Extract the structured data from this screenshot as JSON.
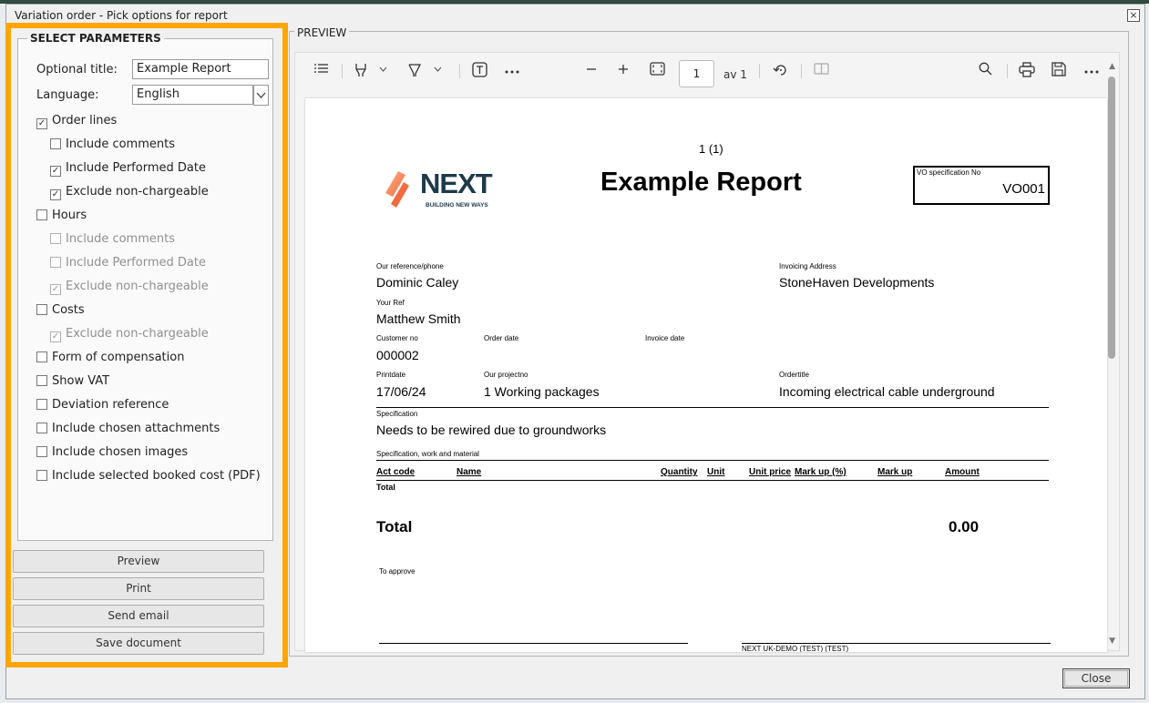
{
  "window": {
    "title": "Variation order - Pick options for report",
    "close_glyph": "×"
  },
  "params": {
    "legend": "SELECT PARAMETERS",
    "optional_title_label": "Optional title:",
    "optional_title_value": "Example Report",
    "language_label": "Language:",
    "language_value": "English",
    "options": [
      {
        "label": "Order lines",
        "checked": true,
        "disabled": false
      },
      {
        "label": "Include comments",
        "checked": false,
        "disabled": false
      },
      {
        "label": "Include Performed Date",
        "checked": true,
        "disabled": false
      },
      {
        "label": "Exclude non-chargeable",
        "checked": true,
        "disabled": false
      },
      {
        "label": "Hours",
        "checked": false,
        "disabled": false
      },
      {
        "label": "Include comments",
        "checked": false,
        "disabled": true
      },
      {
        "label": "Include Performed Date",
        "checked": false,
        "disabled": true
      },
      {
        "label": "Exclude non-chargeable",
        "checked": true,
        "disabled": true
      },
      {
        "label": "Costs",
        "checked": false,
        "disabled": false
      },
      {
        "label": "Exclude non-chargeable",
        "checked": true,
        "disabled": true
      },
      {
        "label": "Form of compensation",
        "checked": false,
        "disabled": false
      },
      {
        "label": "Show VAT",
        "checked": false,
        "disabled": false
      },
      {
        "label": "Deviation reference",
        "checked": false,
        "disabled": false
      },
      {
        "label": "Include chosen attachments",
        "checked": false,
        "disabled": false
      },
      {
        "label": "Include chosen images",
        "checked": false,
        "disabled": false
      },
      {
        "label": "Include selected booked cost (PDF)",
        "checked": false,
        "disabled": false
      }
    ]
  },
  "buttons": {
    "preview": "Preview",
    "print": "Print",
    "send_email": "Send email",
    "save_document": "Save document",
    "close": "Close"
  },
  "preview": {
    "legend": "PREVIEW",
    "toolbar": {
      "page_number": "1",
      "page_of": "av 1"
    },
    "doc": {
      "page_indicator": "1 (1)",
      "logo_text": "NEXT",
      "logo_tagline": "BUILDING NEW WAYS",
      "title": "Example Report",
      "vo_spec_label": "VO specification No",
      "vo_spec_value": "VO001",
      "our_ref_label": "Our reference/phone",
      "our_ref_value": "Dominic Caley",
      "invoicing_address_label": "Invoicing Address",
      "invoicing_address_value": "StoneHaven Developments",
      "your_ref_label": "Your Ref",
      "your_ref_value": "Matthew Smith",
      "customer_no_label": "Customer no",
      "customer_no_value": "000002",
      "order_date_label": "Order date",
      "invoice_date_label": "Invoice date",
      "printdate_label": "Printdate",
      "printdate_value": "17/06/24",
      "projectno_label": "Our projectno",
      "projectno_value": "1 Working packages",
      "ordertitle_label": "Ordertitle",
      "ordertitle_value": "Incoming electrical cable underground",
      "specification_label": "Specification",
      "specification_value": "Needs to be rewired due to groundworks",
      "spec_work_label": "Specification, work and material",
      "columns": [
        "Act code",
        "Name",
        "Quantity",
        "Unit",
        "Unit price",
        "Mark up (%)",
        "Mark up",
        "Amount"
      ],
      "subtotal_label": "Total",
      "total_label": "Total",
      "total_value": "0.00",
      "approve_label": "To approve",
      "footer_company": "NEXT UK-DEMO (TEST) (TEST)"
    }
  },
  "colors": {
    "highlight": "#FFA500",
    "logo_dark": "#1d3a4a",
    "logo_accent": "#f26a3d"
  }
}
